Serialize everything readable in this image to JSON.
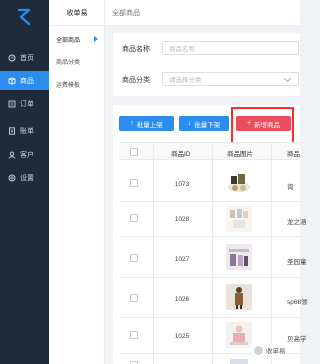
{
  "sidebar": {
    "items": [
      {
        "label": "首页",
        "icon": "home-icon",
        "active": false
      },
      {
        "label": "商品",
        "icon": "product-icon",
        "active": true
      },
      {
        "label": "订单",
        "icon": "order-icon",
        "active": false
      },
      {
        "label": "账单",
        "icon": "bill-icon",
        "active": false
      },
      {
        "label": "客户",
        "icon": "customer-icon",
        "active": false
      },
      {
        "label": "设置",
        "icon": "settings-icon",
        "active": false
      }
    ]
  },
  "subnav": {
    "title": "收单易",
    "items": [
      {
        "label": "全部商品",
        "active": true
      },
      {
        "label": "商品分类",
        "active": false
      },
      {
        "label": "运费模板",
        "active": false
      }
    ]
  },
  "header": {
    "breadcrumb": "全部商品"
  },
  "filter": {
    "name_label": "商品名称",
    "name_placeholder": "商品名称",
    "category_label": "商品分类",
    "category_placeholder": "请选择分类"
  },
  "toolbar": {
    "batch_on": "批量上架",
    "batch_off": "批量下架",
    "add_product": "新增商品"
  },
  "table": {
    "columns": [
      "商品ID",
      "商品图片",
      "商品"
    ],
    "rows": [
      {
        "id": "1073",
        "name": "询"
      },
      {
        "id": "1028",
        "name": "龙之涵"
      },
      {
        "id": "1027",
        "name": "圣园童"
      },
      {
        "id": "1026",
        "name": "sp68领"
      },
      {
        "id": "1025",
        "name": "贝高学"
      },
      {
        "id": "",
        "name": ""
      }
    ]
  },
  "watermark": {
    "text": "收单易"
  },
  "colors": {
    "sidebar_bg": "#1f2b3a",
    "primary": "#2d8cf0",
    "danger": "#ed4c5c",
    "highlight": "#ff2a2a"
  }
}
